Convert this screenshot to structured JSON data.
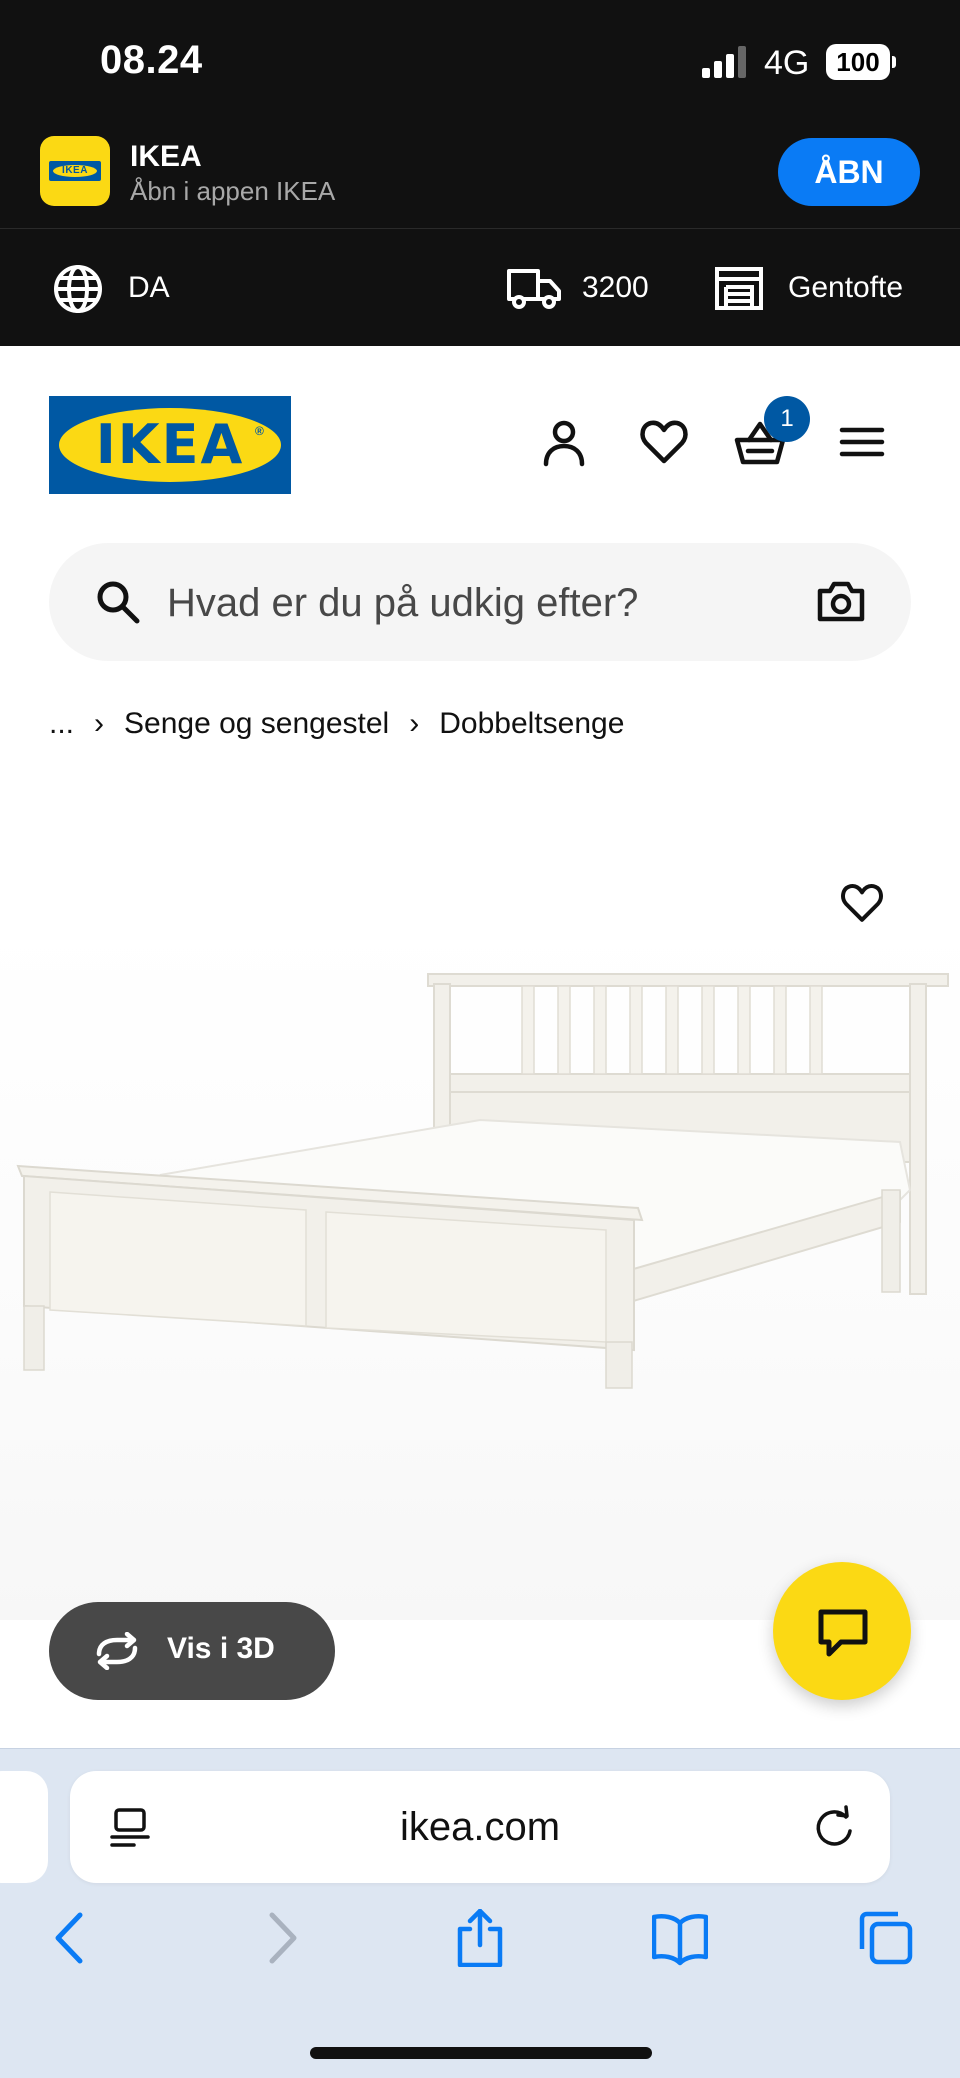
{
  "status_bar": {
    "time": "08.24",
    "network": "4G",
    "battery": "100"
  },
  "app_banner": {
    "name": "IKEA",
    "subtitle": "Åbn i appen IKEA",
    "open_label": "ÅBN"
  },
  "utility_bar": {
    "language": "DA",
    "postal_code": "3200",
    "store": "Gentofte"
  },
  "header": {
    "logo_text": "IKEA",
    "cart_count": "1",
    "icons": [
      "user-icon",
      "heart-icon",
      "basket-icon",
      "menu-icon"
    ]
  },
  "search": {
    "placeholder": "Hvad er du på udkig efter?"
  },
  "breadcrumb": {
    "items": [
      "...",
      "Senge og sengestel",
      "Dobbeltsenge"
    ],
    "separator": "›"
  },
  "product": {
    "view_3d_label": "Vis i 3D"
  },
  "browser": {
    "address": "ikea.com"
  },
  "colors": {
    "brand_blue": "#0058a3",
    "brand_yellow": "#fbd914",
    "ios_blue": "#0a7bf5",
    "dark_band": "#111111"
  }
}
